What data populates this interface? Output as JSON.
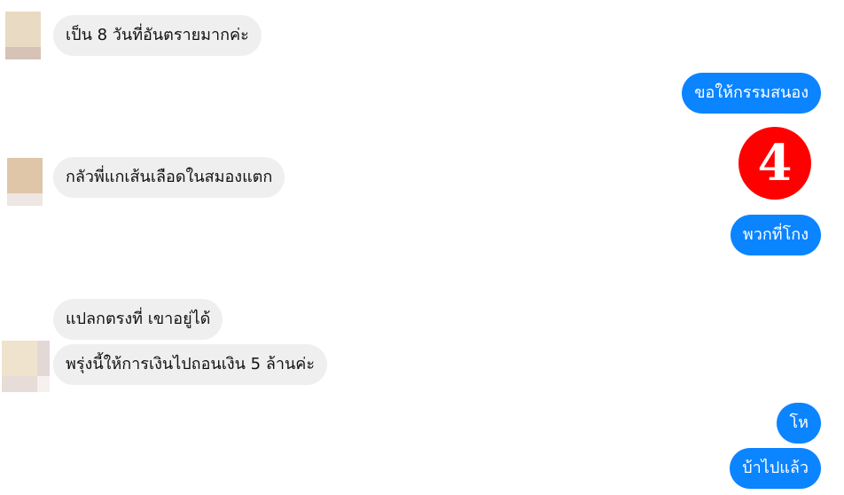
{
  "conversation": {
    "messages": [
      {
        "side": "incoming",
        "text": "เป็น 8 วันที่อันตรายมากค่ะ"
      },
      {
        "side": "outgoing",
        "text": "ขอให้กรรมสนอง"
      },
      {
        "side": "incoming",
        "text": "กลัวพี่แกเส้นเลือดในสมองแตก"
      },
      {
        "side": "outgoing",
        "text": "พวกที่โกง"
      },
      {
        "side": "incoming",
        "text": "แปลกตรงที่ เขาอยู่ได้"
      },
      {
        "side": "incoming",
        "text": "พรุ่งนี้ให้การเงินไปถอนเงิน  5 ล้านค่ะ"
      },
      {
        "side": "outgoing",
        "text": "โห"
      },
      {
        "side": "outgoing",
        "text": "บ้าไปแล้ว"
      }
    ]
  },
  "annotation": {
    "badge_number": "4",
    "badge_color": "#ff0000"
  },
  "colors": {
    "outgoing_bubble": "#0b84ff",
    "incoming_bubble": "#efefef"
  }
}
